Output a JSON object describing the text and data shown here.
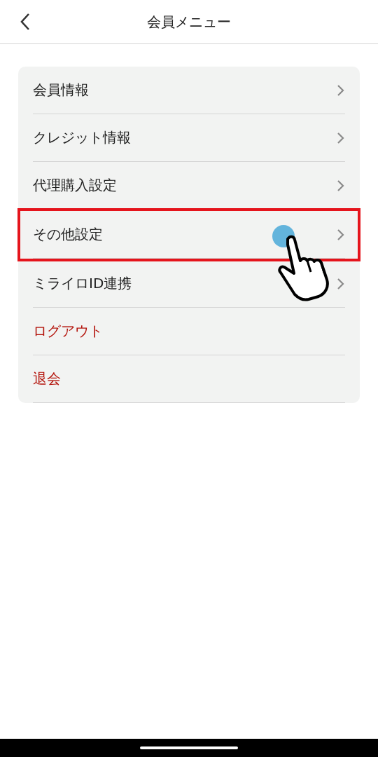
{
  "header": {
    "title": "会員メニュー"
  },
  "menu": [
    {
      "label": "会員情報",
      "kind": "nav",
      "highlighted": false
    },
    {
      "label": "クレジット情報",
      "kind": "nav",
      "highlighted": false
    },
    {
      "label": "代理購入設定",
      "kind": "nav",
      "highlighted": false
    },
    {
      "label": "その他設定",
      "kind": "nav",
      "highlighted": true
    },
    {
      "label": "ミライロID連携",
      "kind": "nav",
      "highlighted": false
    },
    {
      "label": "ログアウト",
      "kind": "danger",
      "highlighted": false
    },
    {
      "label": "退会",
      "kind": "danger",
      "highlighted": false
    }
  ]
}
